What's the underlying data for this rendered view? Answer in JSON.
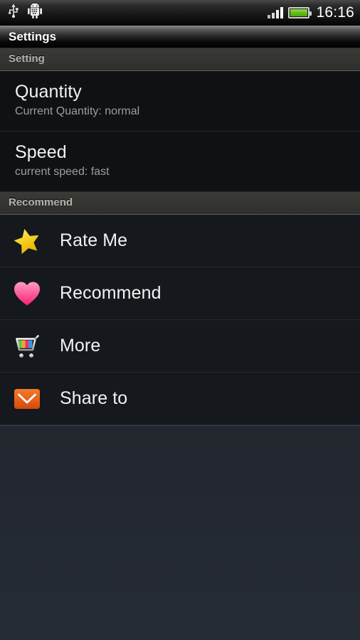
{
  "statusbar": {
    "icons": [
      "usb-icon",
      "android-debug-icon"
    ],
    "signal_bars": 4,
    "battery_icon": "battery-icon",
    "time": "16:16"
  },
  "titlebar": {
    "title": "Settings"
  },
  "sections": [
    {
      "header": "Setting",
      "rows": [
        {
          "title": "Quantity",
          "subtitle": "Current Quantity: normal"
        },
        {
          "title": "Speed",
          "subtitle": "current speed: fast"
        }
      ]
    },
    {
      "header": "Recommend",
      "rows": [
        {
          "label": "Rate Me",
          "icon": "star-icon"
        },
        {
          "label": "Recommend",
          "icon": "heart-icon"
        },
        {
          "label": "More",
          "icon": "shopping-cart-icon"
        },
        {
          "label": "Share to",
          "icon": "envelope-icon"
        }
      ]
    }
  ],
  "colors": {
    "star": "#f5d328",
    "heart": "#fb3b85",
    "cart": "#d9d9d9",
    "envelope": "#e8561b",
    "battery": "#63c11c",
    "row_text": "#f2f2f2",
    "sub_text": "#9e9e9e",
    "section_text": "#b4b4ae"
  }
}
